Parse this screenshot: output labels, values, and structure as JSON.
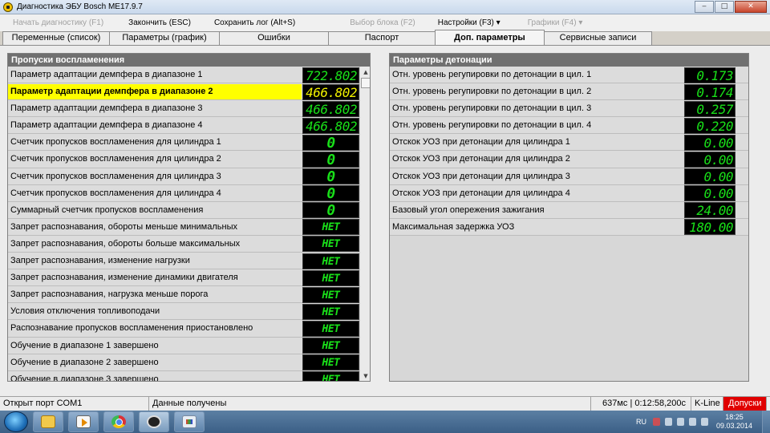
{
  "window": {
    "title": "Диагностика ЭБУ Bosch ME17.9.7",
    "controls": [
      "‒",
      "□",
      "✕"
    ]
  },
  "toolbar": {
    "items": [
      {
        "label": "Начать диагностику (F1)",
        "enabled": false
      },
      {
        "label": "Закончить (ESC)",
        "enabled": true
      },
      {
        "label": "Сохранить лог (Alt+S)",
        "enabled": true
      },
      {
        "label": "Выбор блока (F2)",
        "enabled": false
      },
      {
        "label": "Настройки (F3) ▾",
        "enabled": true
      },
      {
        "label": "Графики (F4) ▾",
        "enabled": false
      }
    ]
  },
  "tabs": [
    {
      "label": "Переменные (список)"
    },
    {
      "label": "Параметры (график)"
    },
    {
      "label": "Ошибки"
    },
    {
      "label": "Паспорт"
    },
    {
      "label": "Доп. параметры",
      "active": true
    },
    {
      "label": "Сервисные записи"
    }
  ],
  "left_panel": {
    "title": "Пропуски воспламенения",
    "rows": [
      {
        "label": "Параметр адаптации демпфера в диапазоне 1",
        "value": "722.802"
      },
      {
        "label": "Параметр адаптации демпфера в диапазоне 2",
        "value": "466.802",
        "selected": true
      },
      {
        "label": "Параметр адаптации демпфера в диапазоне 3",
        "value": "466.802"
      },
      {
        "label": "Параметр адаптации демпфера в диапазоне 4",
        "value": "466.802"
      },
      {
        "label": "Счетчик пропусков воспламенения для цилиндра 1",
        "value": "0"
      },
      {
        "label": "Счетчик пропусков воспламенения для цилиндра 2",
        "value": "0"
      },
      {
        "label": "Счетчик пропусков воспламенения для цилиндра 3",
        "value": "0"
      },
      {
        "label": "Счетчик пропусков воспламенения для цилиндра 4",
        "value": "0"
      },
      {
        "label": "Суммарный счетчик пропусков воспламенения",
        "value": "0"
      },
      {
        "label": "Запрет распознавания, обороты меньше минимальных",
        "value": "НЕТ"
      },
      {
        "label": "Запрет распознавания, обороты больше максимальных",
        "value": "НЕТ"
      },
      {
        "label": "Запрет распознавания, изменение нагрузки",
        "value": "НЕТ"
      },
      {
        "label": "Запрет распознавания, изменение динамики двигателя",
        "value": "НЕТ"
      },
      {
        "label": "Запрет распознавания, нагрузка меньше порога",
        "value": "НЕТ"
      },
      {
        "label": "Условия отключения топливоподачи",
        "value": "НЕТ"
      },
      {
        "label": "Распознавание пропусков воспламенения приостановлено",
        "value": "НЕТ"
      },
      {
        "label": "Обучение в диапазоне 1 завершено",
        "value": "НЕТ"
      },
      {
        "label": "Обучение в диапазоне 2 завершено",
        "value": "НЕТ"
      },
      {
        "label": "Обучение в диапазоне 3 завершено",
        "value": "НЕТ"
      }
    ],
    "scrollbar": {
      "up": "▲",
      "down": "▼"
    }
  },
  "right_panel": {
    "title": "Параметры детонации",
    "rows": [
      {
        "label": "Отн. уровень регупировки по детонации в цил. 1",
        "value": "0.173"
      },
      {
        "label": "Отн. уровень регупировки по детонации в цил. 2",
        "value": "0.174"
      },
      {
        "label": "Отн. уровень регупировки по детонации в цил. 3",
        "value": "0.257"
      },
      {
        "label": "Отн. уровень регупировки по детонации в цил. 4",
        "value": "0.220"
      },
      {
        "label": "Отскок УОЗ при детонации для цилиндра 1",
        "value": "0.00"
      },
      {
        "label": "Отскок УОЗ при детонации для цилиндра 2",
        "value": "0.00"
      },
      {
        "label": "Отскок УОЗ при детонации для цилиндра 3",
        "value": "0.00"
      },
      {
        "label": "Отскок УОЗ при детонации для цилиндра 4",
        "value": "0.00"
      },
      {
        "label": "Базовый угол опережения зажигания",
        "value": "24.00"
      },
      {
        "label": "Максимальная задержка УОЗ",
        "value": "180.00"
      }
    ]
  },
  "statusbar": {
    "port": "Открыт порт COM1",
    "state": "Данные получены",
    "timing": "637мс | 0:12:58,200с",
    "protocol": "K-Line",
    "alert": "Допуски"
  },
  "taskbar": {
    "lang": "RU",
    "time": "18:25",
    "date": "09.03.2014"
  },
  "colors": {
    "lcd_green": "#19e019",
    "lcd_yellow": "#f2f200",
    "selection": "#ffff00",
    "panel_header": "#707070",
    "alert": "#e00000"
  }
}
